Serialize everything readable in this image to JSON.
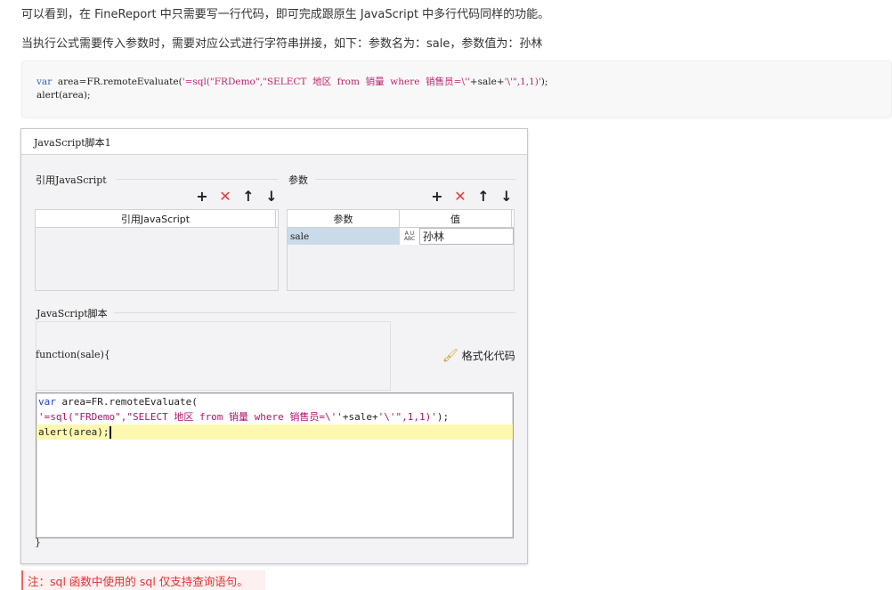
{
  "article": {
    "p1": "可以看到，在 FineReport 中只需要写一行代码，即可完成跟原生 JavaScript 中多行代码同样的功能。",
    "p2": "当执行公式需要传入参数时，需要对应公式进行字符串拼接，如下：参数名为：sale，参数值为：孙林",
    "code": {
      "l1_kw": "var",
      "l1_a": "  area=FR.remoteEvaluate(",
      "l1_str": "'=sql(\"FRDemo\",\"SELECT  地区  from  销量  where  销售员=\\''",
      "l1_b": "+sale+",
      "l1_str2": "'\\'\",1,1)'",
      "l1_c": ");",
      "l2": "alert(area);"
    },
    "note": "注：sql 函数中使用的 sql 仅支持查询语句。"
  },
  "dialog": {
    "tab_title": "JavaScript脚本1",
    "ref_section": {
      "title": "引用JavaScript",
      "column": "引用JavaScript"
    },
    "param_section": {
      "title": "参数",
      "columns": [
        "参数",
        "值"
      ],
      "rows": [
        {
          "name": "sale",
          "type_top": "A U",
          "type_bottom": "ABC",
          "value": "孙林"
        }
      ]
    },
    "toolbar": {
      "add": "+",
      "delete": "✕",
      "up": "↑",
      "down": "↓"
    },
    "script_section": {
      "title": "JavaScript脚本",
      "signature": "function(sale){",
      "format_label": "格式化代码",
      "close": "}"
    },
    "editor": {
      "l1_kw": "var",
      "l1_rest": " area=FR.remoteEvaluate(",
      "l2_str1": "'=sql(\"FRDemo\",\"SELECT 地区 from 销量 where 销售员=\\''",
      "l2_mid": "+sale+",
      "l2_str2": "'\\'\",1,1)'",
      "l2_end": ");",
      "l3_a": "alert",
      "l3_b": "(area);"
    }
  }
}
